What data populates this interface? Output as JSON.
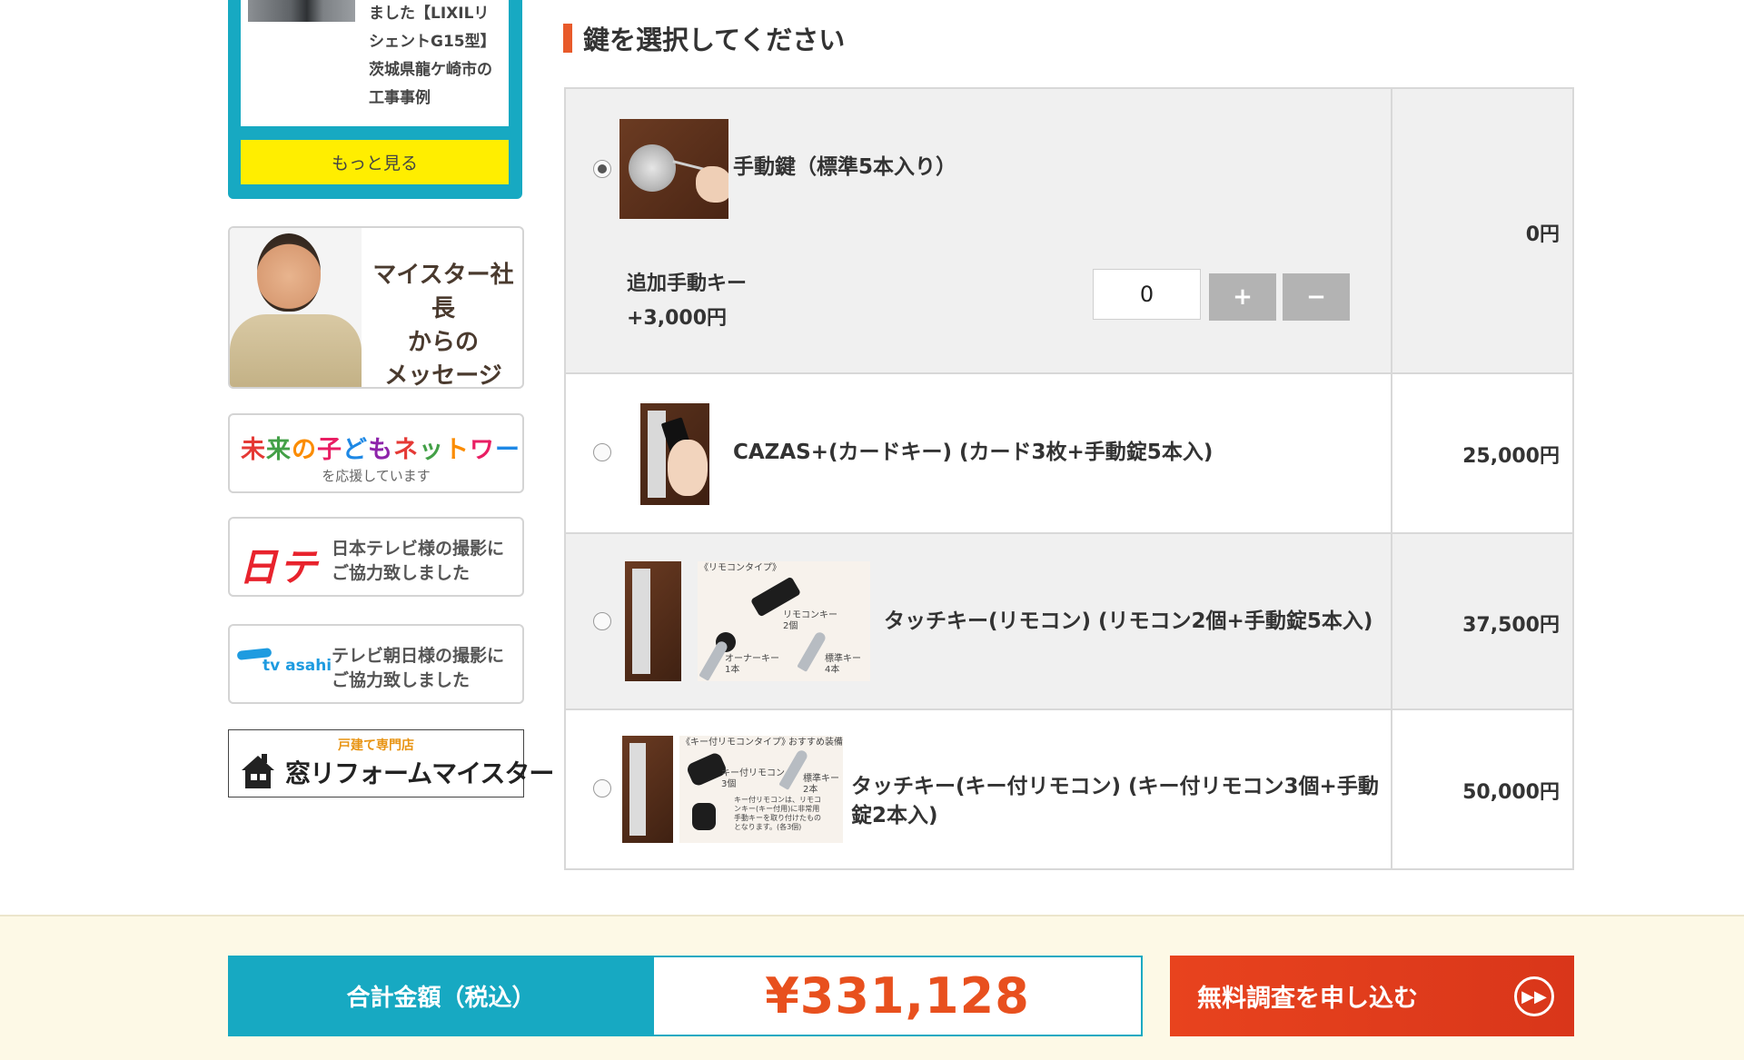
{
  "sidebar": {
    "case_text": "ました【LIXILリ\nシェントG15型】\n茨城県龍ケ崎市の\n工事事例",
    "more_button": "もっと見る",
    "meister_banner": "マイスター社長\nからの\nメッセージ",
    "kodomo_logo": "未来の子どもネットワーク",
    "kodomo_sub": "を応援しています",
    "ntv_logo": "日テレ",
    "ntv_text": "日本テレビ様の撮影に\nご協力致しました",
    "asahi_logo": "tv asahi",
    "asahi_text": "テレビ朝日様の撮影に\nご協力致しました",
    "madoreform_small": "戸建て専門店",
    "madoreform_title": "窓リフォームマイスター"
  },
  "main": {
    "heading": "鍵を選択してください",
    "options": [
      {
        "label": "手動鍵（標準5本入り）",
        "price": "0円",
        "selected": true,
        "extra_key_label": "追加手動キー\n+3,000円",
        "quantity": "0",
        "plus": "+",
        "minus": "−"
      },
      {
        "label": "CAZAS+(カードキー) (カード3枚+手動錠5本入)",
        "price": "25,000円",
        "selected": false
      },
      {
        "label": "タッチキー(リモコン) (リモコン2個+手動錠5本入)",
        "price": "37,500円",
        "selected": false,
        "image_captions": {
          "type": "《リモコンタイプ》",
          "remote": "リモコンキー\n2個",
          "owner": "オーナーキー\n1本",
          "standard": "標準キー\n4本"
        }
      },
      {
        "label": "タッチキー(キー付リモコン) (キー付リモコン3個+手動錠2本入)",
        "price": "50,000円",
        "selected": false,
        "image_captions": {
          "type": "《キー付リモコンタイプ》",
          "recommend": "おすすめ装備",
          "remote": "キー付リモコン\n3個",
          "standard": "標準キー\n2本",
          "note": "キー付リモコンは、リモコ\nンキー(キー付用)に非常用\n手動キーを取り付けたもの\nとなります。(各3個)"
        }
      }
    ]
  },
  "bottom": {
    "total_label": "合計金額（税込）",
    "total_value": "¥331,128",
    "apply_button": "無料調査を申し込む"
  },
  "colors": {
    "teal": "#17a9c2",
    "yellow": "#ffee00",
    "accent_orange": "#e8501e",
    "heading_bar": "#e85a2a",
    "row_alt": "#f0f0f0",
    "bottom_bg": "#fdf9e6"
  },
  "icons": {
    "apply": "fast-forward-circle-icon"
  }
}
